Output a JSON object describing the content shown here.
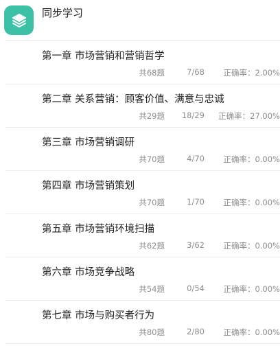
{
  "header": {
    "title": "同步学习",
    "icon": "layers-icon",
    "icon_color": "#3cc0a6"
  },
  "chapters": [
    {
      "title": "第一章 市场营销和营销哲学",
      "total": "共68题",
      "progress": "7/68",
      "accuracy": "正确率：2.00%"
    },
    {
      "title": "第二章 关系营销：顾客价值、满意与忠诚",
      "total": "共29题",
      "progress": "18/29",
      "accuracy": "正确率：27.00%"
    },
    {
      "title": "第三章 市场营销调研",
      "total": "共70题",
      "progress": "4/70",
      "accuracy": "正确率：0.00%"
    },
    {
      "title": "第四章 市场营销策划",
      "total": "共70题",
      "progress": "1/70",
      "accuracy": "正确率：0.00%"
    },
    {
      "title": "第五章 市场营销环境扫描",
      "total": "共62题",
      "progress": "3/62",
      "accuracy": "正确率：0.00%"
    },
    {
      "title": "第六章 市场竞争战略",
      "total": "共54题",
      "progress": "0/54",
      "accuracy": "正确率：0.00%"
    },
    {
      "title": "第七章 市场与购买者行为",
      "total": "共80题",
      "progress": "2/80",
      "accuracy": "正确率：0.00%"
    }
  ]
}
